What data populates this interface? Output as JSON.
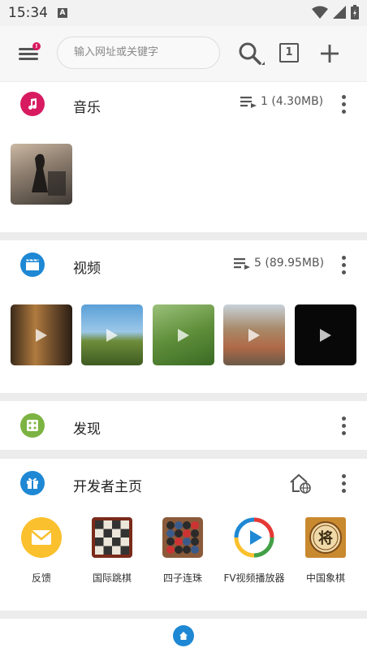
{
  "status_bar": {
    "time": "15:34"
  },
  "toolbar": {
    "search_placeholder": "输入网址或关键字",
    "tab_count": "1",
    "menu_badge": "!"
  },
  "music": {
    "title": "音乐",
    "count": "1 (4.30MB)",
    "icon_color": "#d81b60"
  },
  "video": {
    "title": "视频",
    "count": "5 (89.95MB)",
    "icon_color": "#1e88d4"
  },
  "discover": {
    "title": "发现",
    "icon_color": "#7cb342"
  },
  "developer": {
    "title": "开发者主页",
    "icon_color": "#1e88d4",
    "apps": [
      {
        "label": "反馈",
        "icon": "mail-icon"
      },
      {
        "label": "国际跳棋",
        "icon": "checkers-icon"
      },
      {
        "label": "四子连珠",
        "icon": "connect-four-icon"
      },
      {
        "label": "FV视频播放器",
        "icon": "video-player-icon"
      },
      {
        "label": "中国象棋",
        "icon": "chinese-chess-icon"
      }
    ]
  },
  "colors": {
    "accent_blue": "#1e88d4",
    "music_red": "#d81b60",
    "discover_green": "#7cb342",
    "feedback_yellow": "#fbc02d"
  }
}
